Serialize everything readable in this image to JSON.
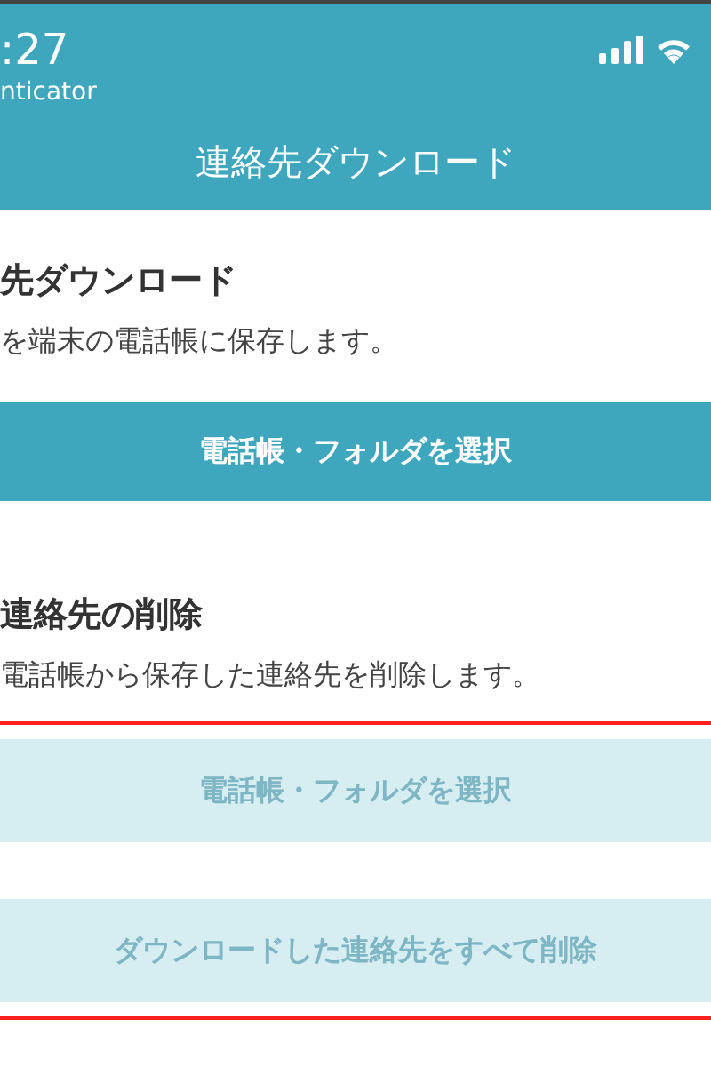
{
  "status_bar": {
    "time": ":27",
    "app": "nticator"
  },
  "nav": {
    "title": "連絡先ダウンロード"
  },
  "sections": [
    {
      "heading": "先ダウンロード",
      "description": "を端末の電話帳に保存します。",
      "buttons": [
        {
          "label": "電話帳・フォルダを選択",
          "disabled": false
        }
      ]
    },
    {
      "heading": "連絡先の削除",
      "description": "電話帳から保存した連絡先を削除します。",
      "outlined": true,
      "buttons": [
        {
          "label": "電話帳・フォルダを選択",
          "disabled": true
        },
        {
          "label": "ダウンロードした連絡先をすべて削除",
          "disabled": true
        }
      ]
    }
  ]
}
